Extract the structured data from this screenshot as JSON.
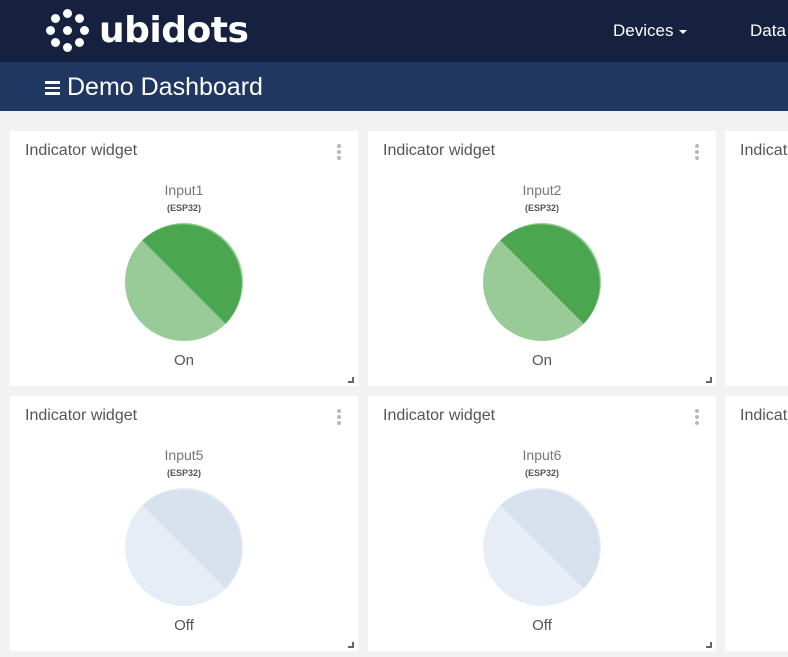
{
  "brand": {
    "name": "ubidots"
  },
  "nav": {
    "items": [
      {
        "label": "Devices",
        "has_dropdown": true
      },
      {
        "label": "Data",
        "has_dropdown": false
      }
    ]
  },
  "dashboard": {
    "title": "Demo Dashboard"
  },
  "colors": {
    "on_dark": "#4aa64f",
    "on_light": "#98cb98",
    "off_dark": "#d8e2ee",
    "off_light": "#e6edf6"
  },
  "widgets": [
    {
      "title": "Indicator widget",
      "variable": "Input1",
      "device": "(ESP32)",
      "state": "On"
    },
    {
      "title": "Indicator widget",
      "variable": "Input2",
      "device": "(ESP32)",
      "state": "On"
    },
    {
      "title": "Indicat",
      "variable": "",
      "device": "",
      "state": ""
    },
    {
      "title": "Indicator widget",
      "variable": "Input5",
      "device": "(ESP32)",
      "state": "Off"
    },
    {
      "title": "Indicator widget",
      "variable": "Input6",
      "device": "(ESP32)",
      "state": "Off"
    },
    {
      "title": "Indicat",
      "variable": "",
      "device": "",
      "state": ""
    }
  ]
}
